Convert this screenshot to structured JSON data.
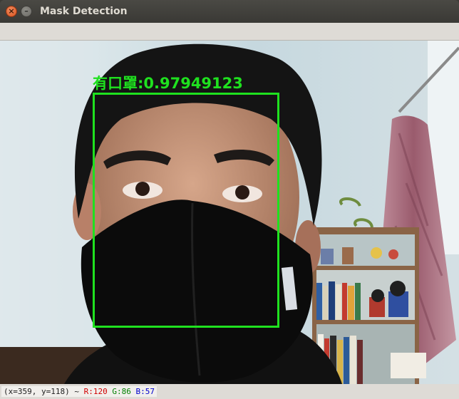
{
  "window": {
    "title": "Mask Detection",
    "close_glyph": "×",
    "minimize_glyph": "–"
  },
  "detection": {
    "label": "有口罩:0.97949123",
    "box_color": "#1fe11f"
  },
  "status": {
    "coords": "(x=359, y=118) ~",
    "r": "R:120",
    "g": "G:86",
    "b": "B:57"
  },
  "icons": [
    "close-icon",
    "minimize-icon"
  ]
}
